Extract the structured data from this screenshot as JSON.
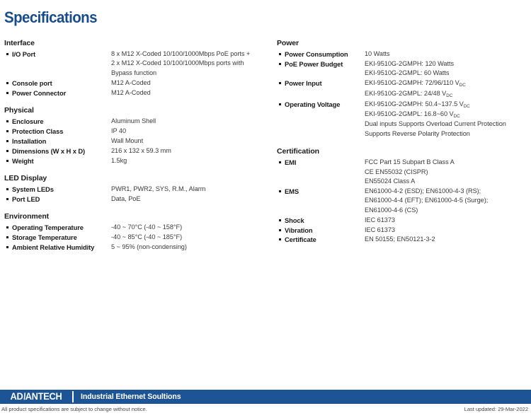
{
  "page": {
    "title": "Specifications"
  },
  "colors": {
    "title_blue": "#1a4c8b",
    "footer_bar_blue": "#1d5496",
    "body_text": "#3a3a3a",
    "label_text": "#1a1a1a"
  },
  "left_column": [
    {
      "heading": "Interface",
      "rows": [
        {
          "label": "I/O Port",
          "lines": [
            "8 x M12 X-Coded 10/100/1000Mbps PoE ports +",
            "2 x M12 X-Coded 10/100/1000Mbps ports with",
            "Bypass function"
          ]
        },
        {
          "label": "Console port",
          "lines": [
            "M12 A-Coded"
          ]
        },
        {
          "label": "Power Connector",
          "lines": [
            "M12 A-Coded"
          ]
        }
      ]
    },
    {
      "heading": "Physical",
      "rows": [
        {
          "label": "Enclosure",
          "lines": [
            "Aluminum Shell"
          ]
        },
        {
          "label": "Protection Class",
          "lines": [
            "IP 40"
          ]
        },
        {
          "label": "Installation",
          "lines": [
            "Wall Mount"
          ]
        },
        {
          "label": "Dimensions (W x H x D)",
          "lines": [
            "216 x 132 x 59.3 mm"
          ]
        },
        {
          "label": "Weight",
          "lines": [
            "1.5kg"
          ]
        }
      ]
    },
    {
      "heading": "LED Display",
      "rows": [
        {
          "label": "System LEDs",
          "lines": [
            "PWR1, PWR2, SYS, R.M., Alarm"
          ]
        },
        {
          "label": "Port LED",
          "lines": [
            "Data, PoE"
          ]
        }
      ]
    },
    {
      "heading": "Environment",
      "rows": [
        {
          "label": "Operating Temperature",
          "lines": [
            "-40 ~ 70°C (-40 ~ 158°F)"
          ]
        },
        {
          "label": "Storage Temperature",
          "lines": [
            "-40 ~ 85°C (-40 ~ 185°F)"
          ]
        },
        {
          "label": "Ambient Relative Humidity",
          "lines": [
            "5 ~ 95% (non-condensing)"
          ]
        }
      ]
    }
  ],
  "right_column": [
    {
      "heading": "Power",
      "rows": [
        {
          "label": "Power Consumption",
          "lines": [
            "10 Watts"
          ]
        },
        {
          "label": "PoE Power Budget",
          "lines": [
            "EKI-9510G-2GMPH: 120 Watts",
            "EKI-9510G-2GMPL: 60 Watts"
          ]
        },
        {
          "label": "Power Input",
          "lines_html": [
            "EKI-9510G-2GMPH: 72/96/110 V<sub>DC</sub>",
            "EKI-9510G-2GMPL: 24/48 V<sub>DC</sub>"
          ]
        },
        {
          "label": "Operating Voltage",
          "lines_html": [
            "EKI-9510G-2GMPH: 50.4~137.5 V<sub>DC</sub>",
            "EKI-9510G-2GMPL: 16.8~60 V<sub>DC</sub>",
            "Dual inputs Supports Overload Current Protection",
            "Supports Reverse Polarity Protection"
          ]
        }
      ]
    },
    {
      "heading": "Certification",
      "rows": [
        {
          "label": "EMI",
          "lines": [
            "FCC Part 15 Subpart B Class A",
            "CE EN55032 (CISPR)",
            "EN55024 Class A"
          ]
        },
        {
          "label": "EMS",
          "lines": [
            "EN61000-4-2 (ESD); EN61000-4-3 (RS);",
            "EN61000-4-4 (EFT); EN61000-4-5 (Surge);",
            "EN61000-4-6 (CS)"
          ]
        },
        {
          "label": "Shock",
          "lines": [
            "IEC 61373"
          ]
        },
        {
          "label": "Vibration",
          "lines": [
            "IEC 61373"
          ]
        },
        {
          "label": "Certificate",
          "lines": [
            "EN 50155; EN50121-3-2"
          ]
        }
      ]
    }
  ],
  "footer": {
    "logo_text_1": "AD",
    "logo_slash": "\\",
    "logo_text_2": "ANTECH",
    "tagline": "Industrial Ethernet Soultions",
    "note": "All product specifications are subject to change without notice.",
    "updated": "Last updated: 29-Mar-2022"
  }
}
